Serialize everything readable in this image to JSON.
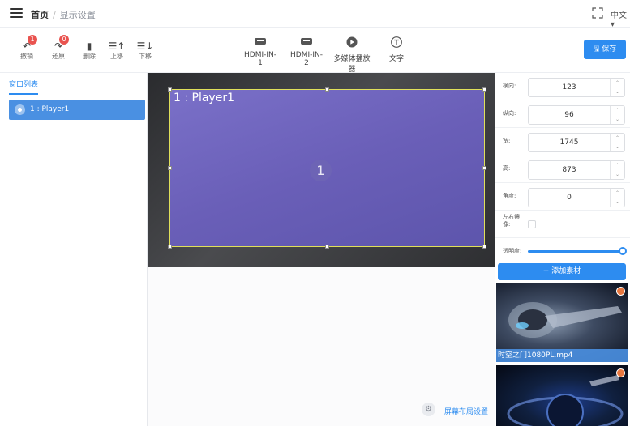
{
  "header": {
    "breadcrumb_home": "首页",
    "breadcrumb_separator": "/",
    "breadcrumb_current": "显示设置",
    "language": "中文 ▾"
  },
  "toolbar": {
    "undo_label": "撤销",
    "undo_badge": "1",
    "redo_label": "还原",
    "redo_badge": "0",
    "delete_label": "删除",
    "move_up_label": "上移",
    "move_down_label": "下移",
    "sources": [
      "HDMI-IN-1",
      "HDMI-IN-2",
      "多媒体播放器",
      "文字"
    ],
    "save_label": "保存"
  },
  "left_panel": {
    "title": "窗口列表",
    "items": [
      {
        "label": "1 : Player1",
        "selected": true
      }
    ]
  },
  "canvas": {
    "window_title": "1 : Player1",
    "window_number": "1",
    "layout_settings_label": "屏幕布局设置"
  },
  "properties": {
    "x": {
      "label": "横向:",
      "value": "123"
    },
    "y": {
      "label": "纵向:",
      "value": "96"
    },
    "width": {
      "label": "宽:",
      "value": "1745"
    },
    "height": {
      "label": "高:",
      "value": "873"
    },
    "angle": {
      "label": "角度:",
      "value": "0"
    },
    "mirror": {
      "label": "左右镜像:",
      "checked": false
    },
    "opacity": {
      "label": "透明度:",
      "value_percent": 100
    },
    "add_material_label": "+ 添加素材"
  },
  "media": [
    {
      "caption": "时空之门1080PL.mp4"
    },
    {
      "caption": ""
    }
  ],
  "colors": {
    "accent": "#2d8cf0",
    "window_fill": "#6a5fb8",
    "window_border": "#e0e05a",
    "badge": "#e9534f"
  }
}
